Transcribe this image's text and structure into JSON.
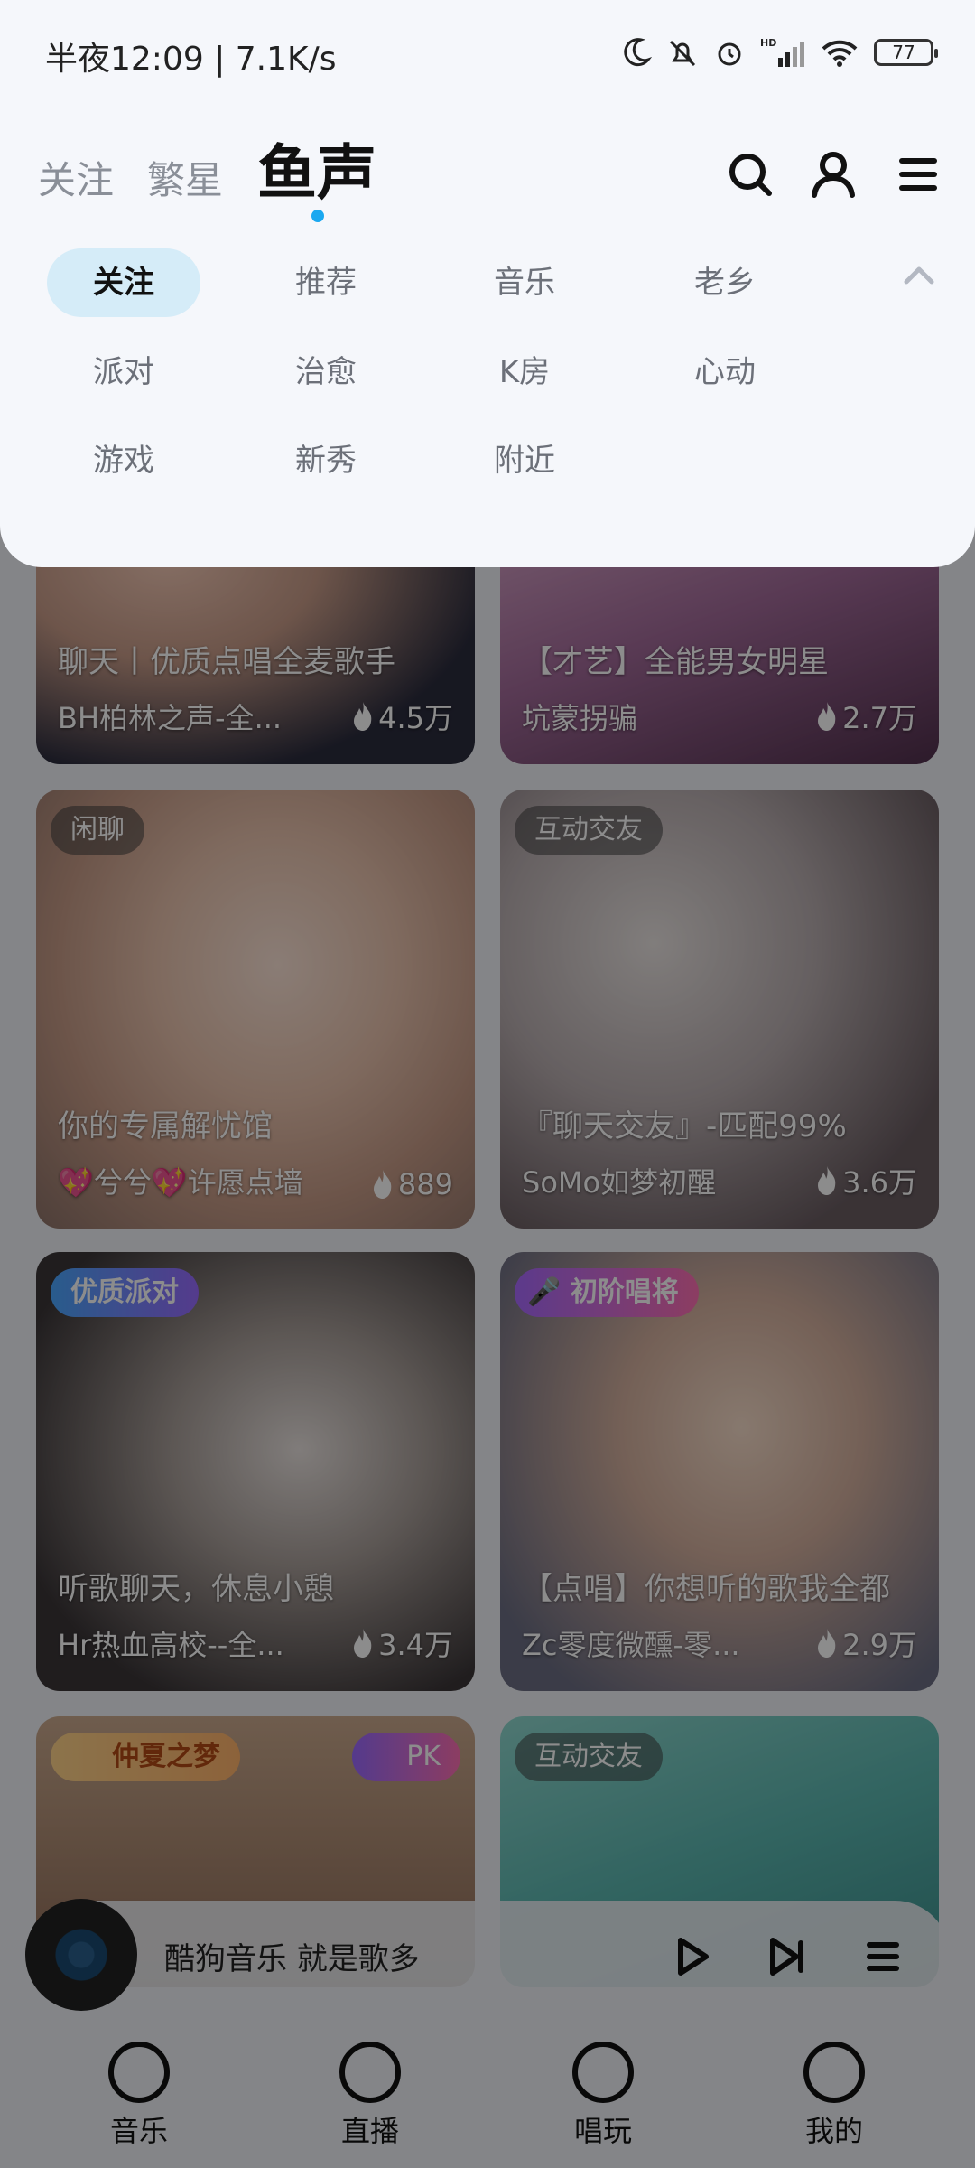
{
  "status_bar": {
    "time": "半夜12:09 | 7.1K/s",
    "battery": "77"
  },
  "header": {
    "tabs": [
      {
        "label": "关注"
      },
      {
        "label": "繁星"
      },
      {
        "label": "鱼声"
      }
    ]
  },
  "categories": [
    "关注",
    "推荐",
    "音乐",
    "老乡",
    "派对",
    "治愈",
    "K房",
    "心动",
    "游戏",
    "新秀",
    "附近"
  ],
  "cards": [
    {
      "title": "聊天丨优质点唱全麦歌手",
      "host": "BH柏林之声-全...",
      "heat": "4.5万"
    },
    {
      "title": "【才艺】全能男女明星",
      "host": "坑蒙拐骗",
      "heat": "2.7万"
    },
    {
      "tag": "闲聊",
      "title": "你的专属解忧馆",
      "host": "💖兮兮💖许愿点墙",
      "heat": "889"
    },
    {
      "tag": "互动交友",
      "title": "『聊天交友』-匹配99%",
      "host": "SoMo如梦初醒",
      "heat": "3.6万"
    },
    {
      "tag": "优质派对",
      "title": "听歌聊天，休息小憩",
      "host": "Hr热血高校--全...",
      "heat": "3.4万"
    },
    {
      "tag": "初阶唱将",
      "title": "【点唱】你想听的歌我全都",
      "host": "Zc零度微醺-零...",
      "heat": "2.9万"
    },
    {
      "tag": "仲夏之梦",
      "tag2": "PK"
    },
    {
      "tag": "互动交友"
    }
  ],
  "player": {
    "text": "酷狗音乐  就是歌多"
  },
  "bottom_nav": [
    {
      "label": "音乐"
    },
    {
      "label": "直播"
    },
    {
      "label": "唱玩"
    },
    {
      "label": "我的"
    }
  ]
}
